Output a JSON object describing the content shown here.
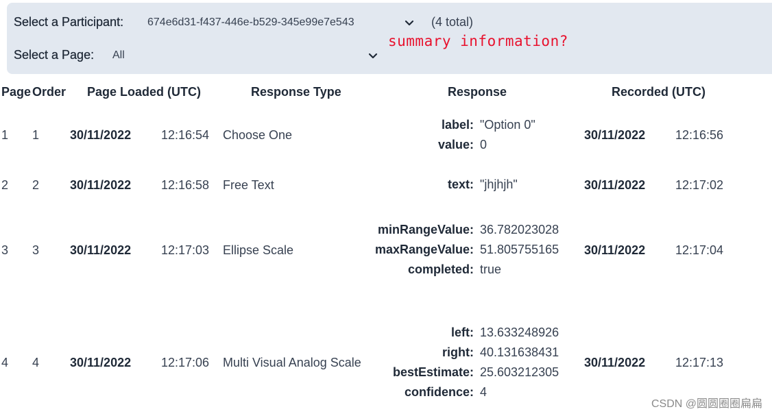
{
  "controls": {
    "participant_label": "Select a Participant:",
    "participant_value": "674e6d31-f437-446e-b529-345e99e7e543",
    "total_text": "(4 total)",
    "page_label": "Select a Page:",
    "page_value": "All"
  },
  "annotation": "summary information?",
  "table": {
    "headers": [
      "Page",
      "Order",
      "Page Loaded (UTC)",
      "Response Type",
      "Response",
      "Recorded (UTC)"
    ],
    "rows": [
      {
        "page": "1",
        "order": "1",
        "loaded_date": "30/11/2022",
        "loaded_time": "12:16:54",
        "type": "Choose One",
        "response": [
          {
            "key": "label:",
            "value": "\"Option 0\""
          },
          {
            "key": "value:",
            "value": "0"
          }
        ],
        "recorded_date": "30/11/2022",
        "recorded_time": "12:16:56"
      },
      {
        "page": "2",
        "order": "2",
        "loaded_date": "30/11/2022",
        "loaded_time": "12:16:58",
        "type": "Free Text",
        "response": [
          {
            "key": "text:",
            "value": "\"jhjhjh\""
          }
        ],
        "recorded_date": "30/11/2022",
        "recorded_time": "12:17:02"
      },
      {
        "page": "3",
        "order": "3",
        "loaded_date": "30/11/2022",
        "loaded_time": "12:17:03",
        "type": "Ellipse Scale",
        "response": [
          {
            "key": "minRangeValue:",
            "value": "36.782023028"
          },
          {
            "key": "maxRangeValue:",
            "value": "51.805755165"
          },
          {
            "key": "completed:",
            "value": "true"
          }
        ],
        "recorded_date": "30/11/2022",
        "recorded_time": "12:17:04"
      },
      {
        "page": "4",
        "order": "4",
        "loaded_date": "30/11/2022",
        "loaded_time": "12:17:06",
        "type": "Multi Visual Analog Scale",
        "response": [
          {
            "key": "left:",
            "value": "13.633248926"
          },
          {
            "key": "right:",
            "value": "40.131638431"
          },
          {
            "key": "bestEstimate:",
            "value": "25.603212305"
          },
          {
            "key": "confidence:",
            "value": "4"
          }
        ],
        "recorded_date": "30/11/2022",
        "recorded_time": "12:17:13"
      }
    ]
  },
  "watermark": "CSDN @圆圆圈圈扁扁",
  "colors": {
    "panel_bg": "#e2e8f0",
    "annotation": "#e8112d"
  }
}
